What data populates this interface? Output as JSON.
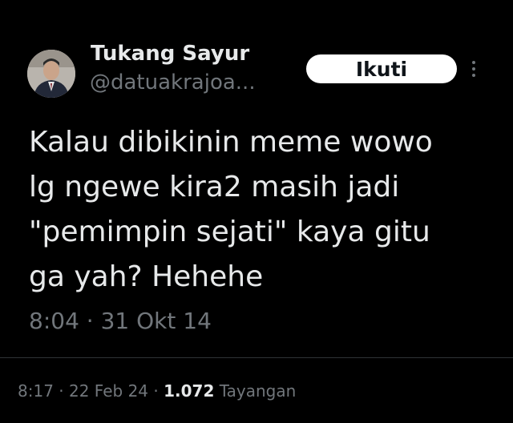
{
  "author": {
    "name": "Tukang Sayur",
    "handle": "@datuakrajoa..."
  },
  "follow_button": {
    "label": "Ikuti"
  },
  "more_button": {
    "icon": "more-vertical-icon"
  },
  "tweet": {
    "lines": [
      "Kalau dibikinin meme wowo",
      "lg ngewe kira2 masih jadi",
      "\"pemimpin sejati\" kaya gitu",
      "ga yah? Hehehe"
    ],
    "time": "8:04",
    "separator": " · ",
    "date": "31 Okt 14"
  },
  "meta": {
    "time": "8:17",
    "separator": " · ",
    "date": "22 Feb 24",
    "views_count": "1.072",
    "views_label": "Tayangan"
  },
  "colors": {
    "background": "#000000",
    "primary_text": "#e7e9ea",
    "secondary_text": "#71767b",
    "button_background": "#ffffff",
    "button_text": "#0f1419"
  }
}
